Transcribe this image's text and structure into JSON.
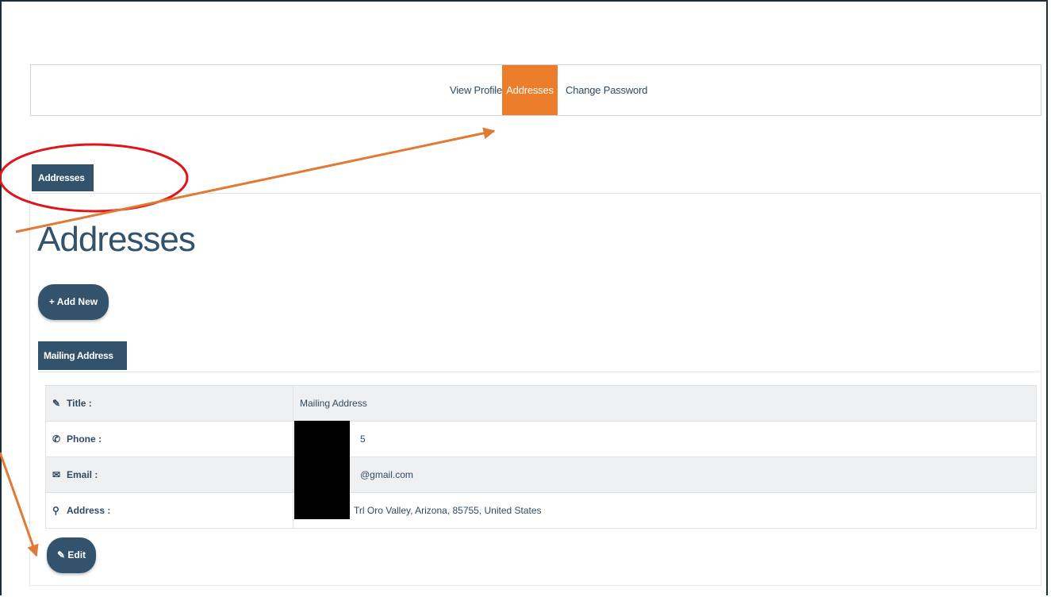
{
  "tabs": {
    "view_profile": "View Profile",
    "addresses": "Addresses",
    "change_password": "Change Password"
  },
  "section_badge": "Addresses",
  "page_title": "Addresses",
  "add_new_button": "+ Add New",
  "mailing_badge": "Mailing Address",
  "rows": [
    {
      "icon": "edit-icon",
      "label": "Title :",
      "value": "Mailing Address"
    },
    {
      "icon": "phone-icon",
      "label": "Phone :",
      "value": "5"
    },
    {
      "icon": "envelope-icon",
      "label": "Email :",
      "value": "@gmail.com"
    },
    {
      "icon": "map-marker-icon",
      "label": "Address :",
      "value": "Trl Oro Valley, Arizona, 85755, United States"
    }
  ],
  "edit_button": "Edit",
  "colors": {
    "primary": "#33526c",
    "accent": "#ec7e2b",
    "annotation_circle": "#e0141b",
    "annotation_arrow": "#e07a35"
  }
}
